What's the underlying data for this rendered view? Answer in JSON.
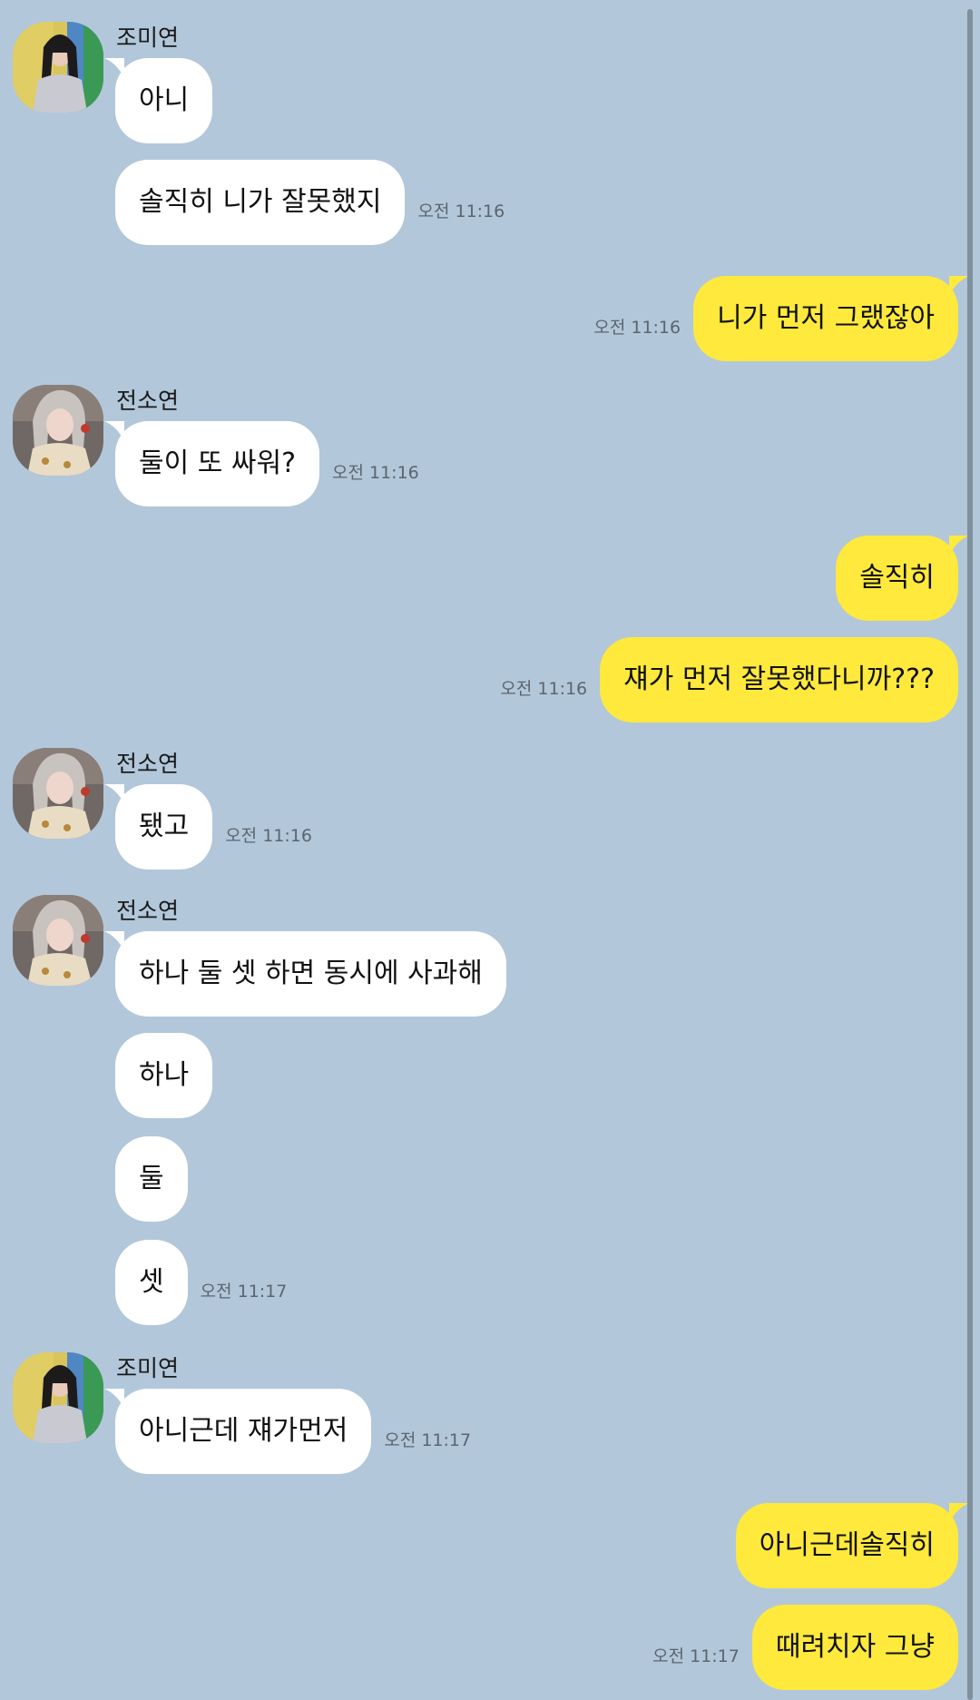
{
  "colors": {
    "background": "#b2c7da",
    "incoming_bubble": "#ffffff",
    "outgoing_bubble": "#fee93c",
    "timestamp": "#5b6570"
  },
  "groups": [
    {
      "sender": "조미연",
      "avatar": "avatar-photo-jomiyeon",
      "messages": [
        {
          "text": "아니"
        },
        {
          "text": "솔직히 니가 잘못했지",
          "time": "오전 11:16"
        }
      ]
    },
    {
      "messages": [
        {
          "text": "니가 먼저 그랬잖아",
          "time": "오전 11:16"
        }
      ]
    },
    {
      "sender": "전소연",
      "avatar": "avatar-photo-jeonsoyeon",
      "messages": [
        {
          "text": "둘이 또 싸워?",
          "time": "오전 11:16"
        }
      ]
    },
    {
      "messages": [
        {
          "text": "솔직히"
        },
        {
          "text": "쟤가 먼저 잘못했다니까???",
          "time": "오전 11:16"
        }
      ]
    },
    {
      "sender": "전소연",
      "avatar": "avatar-photo-jeonsoyeon",
      "messages": [
        {
          "text": "됐고",
          "time": "오전 11:16"
        }
      ]
    },
    {
      "sender": "전소연",
      "avatar": "avatar-photo-jeonsoyeon",
      "messages": [
        {
          "text": "하나 둘 셋 하면 동시에 사과해"
        },
        {
          "text": "하나"
        },
        {
          "text": "둘"
        },
        {
          "text": "셋",
          "time": "오전 11:17"
        }
      ]
    },
    {
      "sender": "조미연",
      "avatar": "avatar-photo-jomiyeon",
      "messages": [
        {
          "text": "아니근데 쟤가먼저",
          "time": "오전 11:17"
        }
      ]
    },
    {
      "messages": [
        {
          "text": "아니근데솔직히"
        },
        {
          "text": "때려치자 그냥",
          "time": "오전 11:17"
        }
      ]
    }
  ]
}
